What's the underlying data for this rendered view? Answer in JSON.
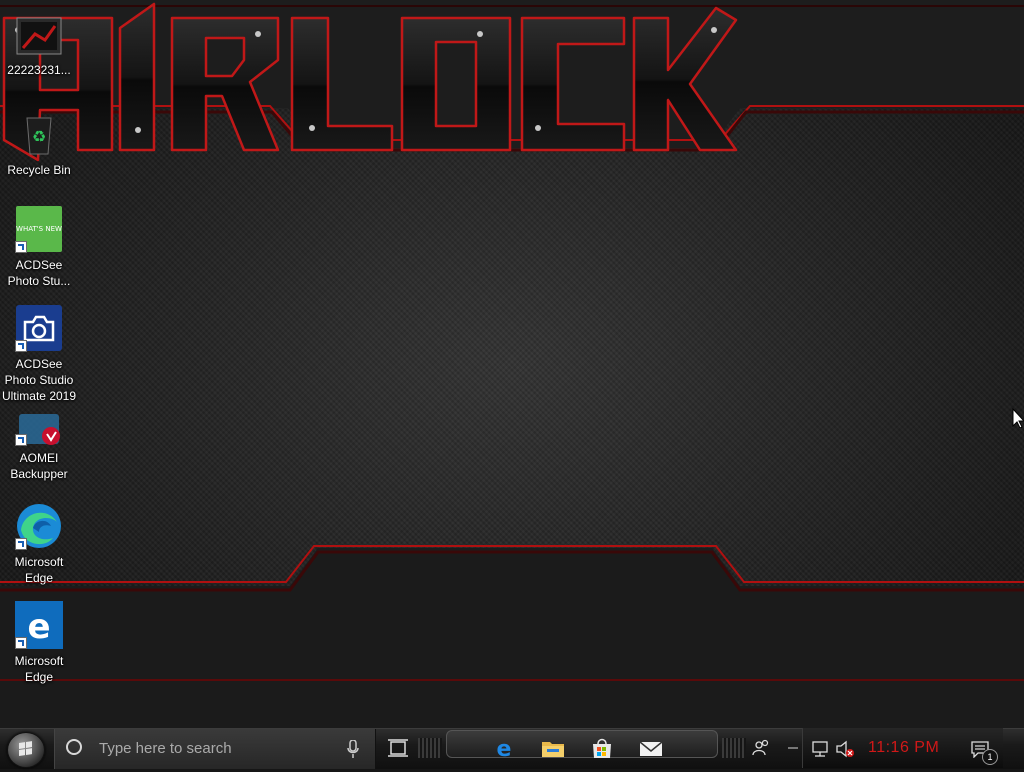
{
  "desktop": {
    "wallpaper_text": "AIRLOCK",
    "icons": [
      {
        "label": "22223231..."
      },
      {
        "label": "Recycle Bin"
      },
      {
        "label": "ACDSee Photo Stu..."
      },
      {
        "label": "ACDSee Photo Studio Ultimate 2019"
      },
      {
        "label": "AOMEI Backupper"
      },
      {
        "label": "Microsoft Edge"
      },
      {
        "label": "Microsoft Edge"
      }
    ],
    "acdsee_badge_text": "WHAT'S NEW"
  },
  "taskbar": {
    "search_placeholder": "Type here to search",
    "pinned_icons": [
      "edge-icon",
      "file-explorer-icon",
      "store-icon",
      "mail-icon"
    ],
    "tray": {
      "clock": "11:16 PM",
      "notification_count": "1"
    }
  },
  "colors": {
    "accent_red": "#d01818",
    "taskbar_bg": "#1a1a1a"
  }
}
